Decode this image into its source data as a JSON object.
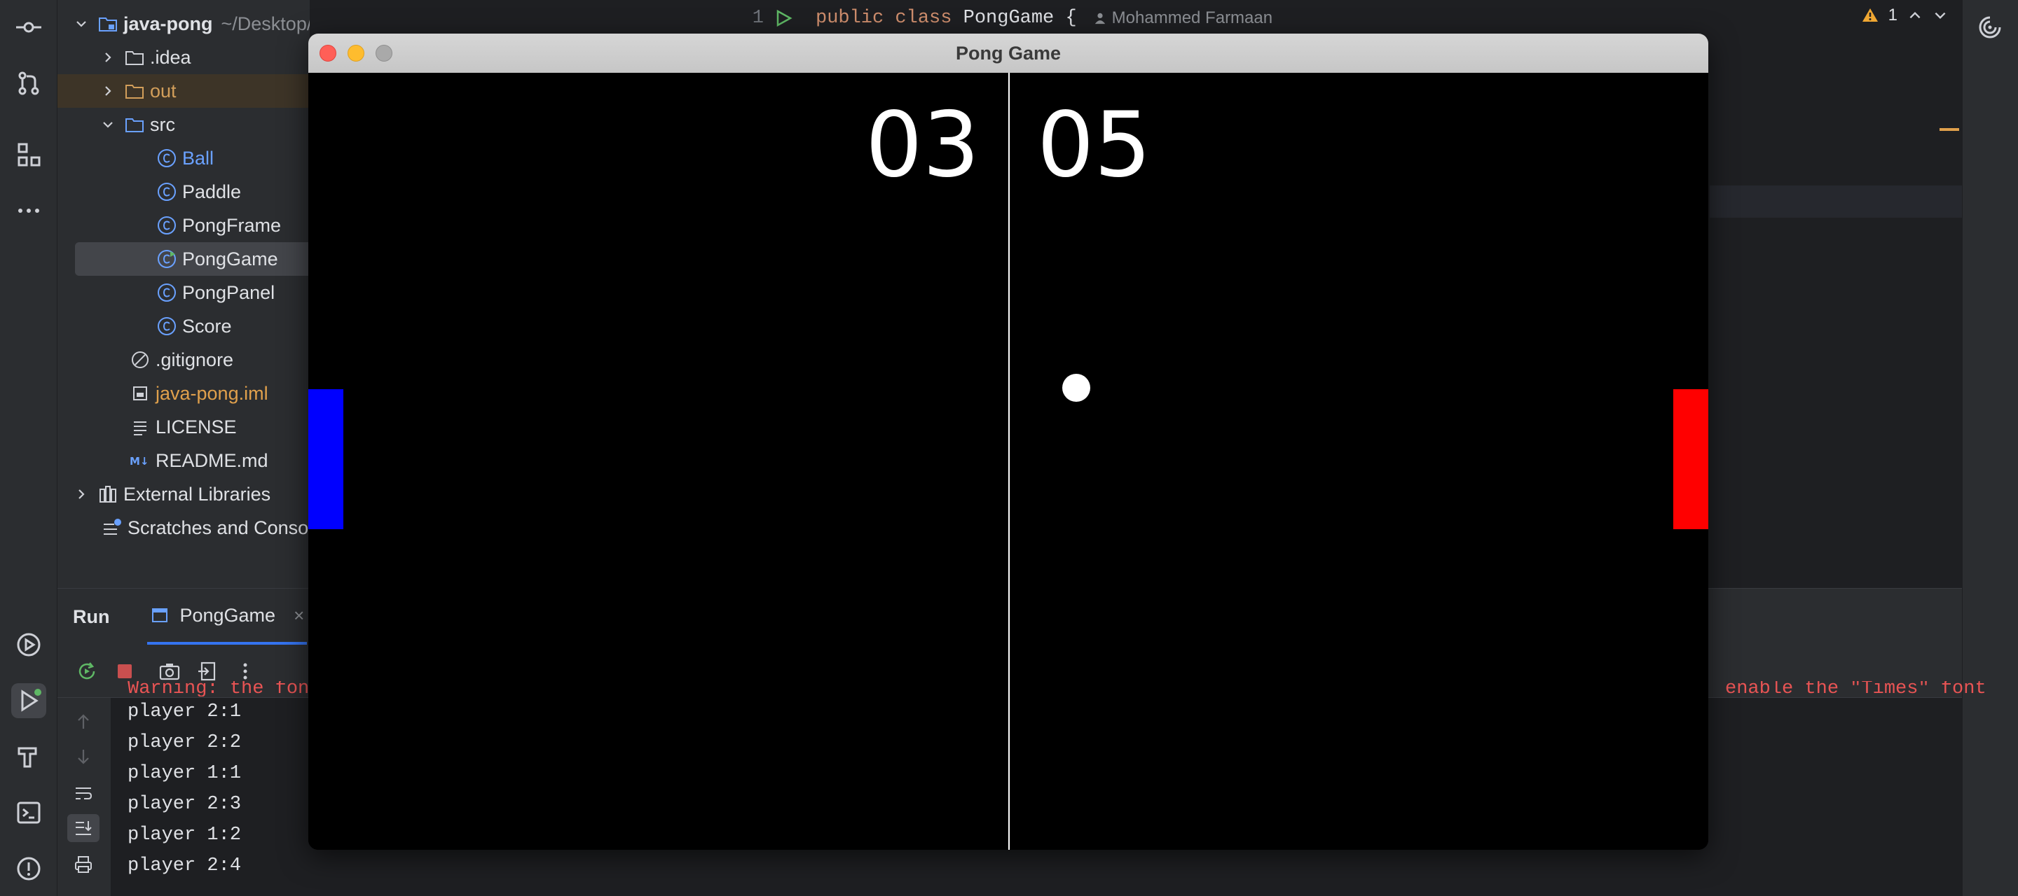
{
  "project_tree": {
    "root": {
      "name": "java-pong",
      "path": "~/Desktop/Dev/Projects/java-pong"
    },
    "items": [
      {
        "label": ".idea"
      },
      {
        "label": "out"
      },
      {
        "label": "src"
      },
      {
        "label": "Ball"
      },
      {
        "label": "Paddle"
      },
      {
        "label": "PongFrame"
      },
      {
        "label": "PongGame"
      },
      {
        "label": "PongPanel"
      },
      {
        "label": "Score"
      },
      {
        "label": ".gitignore"
      },
      {
        "label": "java-pong.iml"
      },
      {
        "label": "LICENSE"
      },
      {
        "label": "README.md"
      },
      {
        "label": "External Libraries"
      },
      {
        "label": "Scratches and Consoles"
      }
    ]
  },
  "editor": {
    "line_number": "1",
    "code": {
      "kw1": "public",
      "kw2": "class",
      "class_name": "PongGame",
      "brace": "{"
    },
    "author": "Mohammed Farmaan",
    "warnings_count": "1"
  },
  "run_window": {
    "title": "Run",
    "tab_label": "PongGame",
    "tab_close": "×",
    "console": {
      "warning_left": "Warning: the font",
      "warning_right": "enable the \"Times\" font",
      "lines": [
        "player 2:1",
        "player 2:2",
        "player 1:1",
        "player 2:3",
        "player 1:2",
        "player 2:4"
      ]
    }
  },
  "pong": {
    "window_title": "Pong Game",
    "score_left": "03",
    "score_right": "05",
    "colors": {
      "left_paddle": "#0000ff",
      "right_paddle": "#ff0000",
      "ball": "#ffffff",
      "background": "#000000"
    }
  }
}
